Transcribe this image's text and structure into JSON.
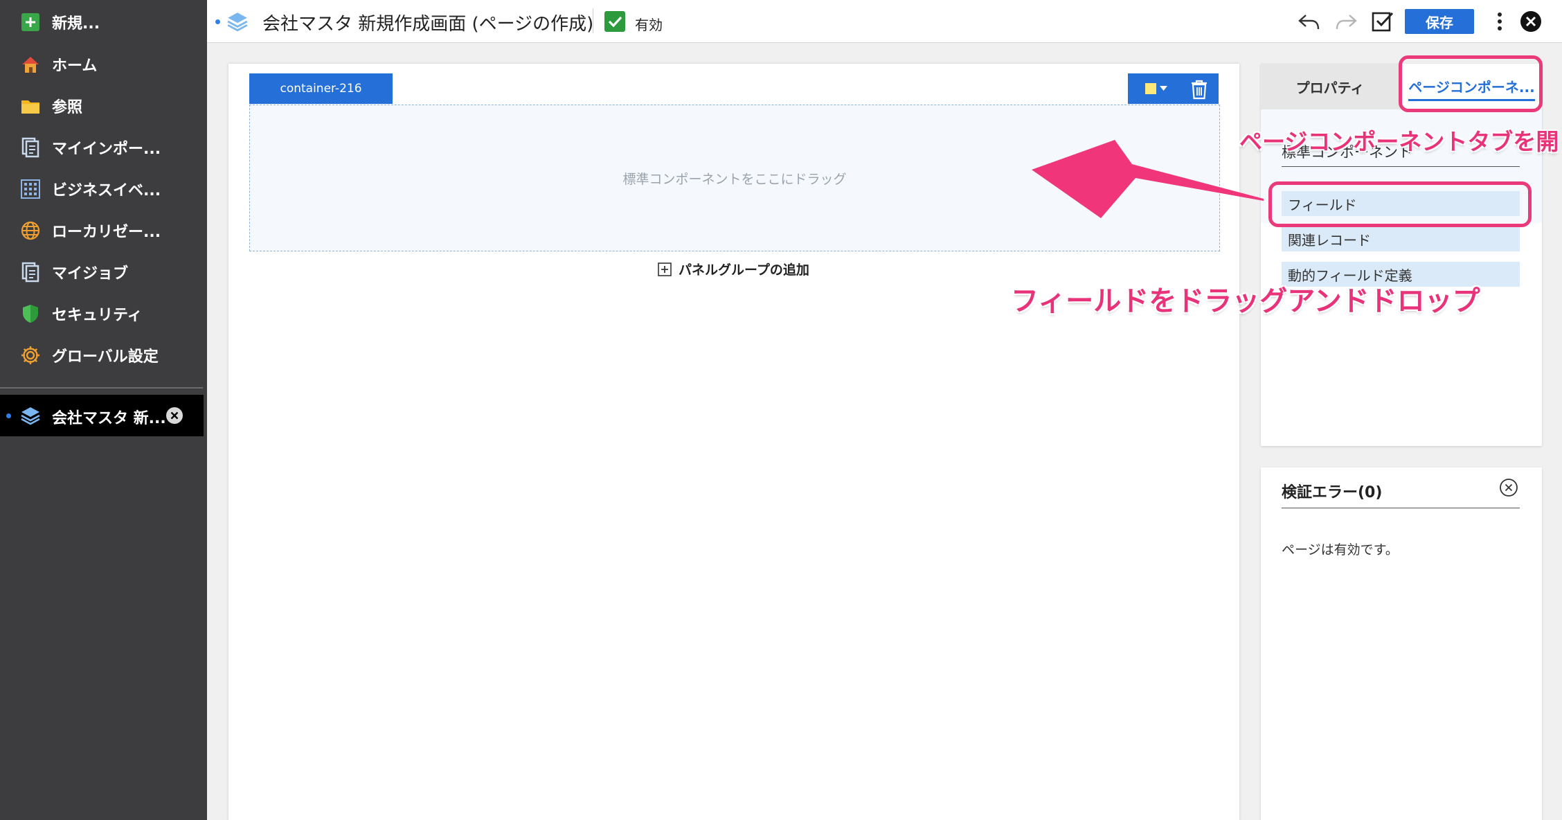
{
  "sidebar": {
    "new_label": "新規...",
    "items": [
      {
        "label": "ホーム",
        "icon": "home-icon"
      },
      {
        "label": "参照",
        "icon": "folder-icon"
      },
      {
        "label": "マイインポー...",
        "icon": "document-icon"
      },
      {
        "label": "ビジネスイベ...",
        "icon": "grid-icon"
      },
      {
        "label": "ローカリゼー...",
        "icon": "globe-icon"
      },
      {
        "label": "マイジョブ",
        "icon": "document-icon"
      },
      {
        "label": "セキュリティ",
        "icon": "shield-icon"
      },
      {
        "label": "グローバル設定",
        "icon": "gear-icon"
      }
    ],
    "open_tab_label": "会社マスタ 新..."
  },
  "header": {
    "title": "会社マスタ 新規作成画面 (ページの作成)",
    "active_label": "有効",
    "save_label": "保存"
  },
  "canvas": {
    "container_name": "container-216",
    "drop_placeholder": "標準コンポーネントをここにドラッグ",
    "add_panel_group_label": "パネルグループの追加"
  },
  "right_panel": {
    "tabs": [
      "プロパティ",
      "ページコンポーネ..."
    ],
    "section_title": "標準コンポーネント",
    "components": [
      "フィールド",
      "関連レコード",
      "動的フィールド定義"
    ]
  },
  "errors_panel": {
    "title": "検証エラー(0)",
    "message": "ページは有効です。"
  },
  "annotations": {
    "open_tab": "ページコンポーネントタブを開く",
    "drag_drop": "フィールドをドラッグアンドドロップ"
  },
  "colors": {
    "accent": "#2470d8",
    "annotation": "#ea3a7a",
    "sidebar_bg": "#3d3d3f",
    "active_check": "#2e9a3e"
  }
}
